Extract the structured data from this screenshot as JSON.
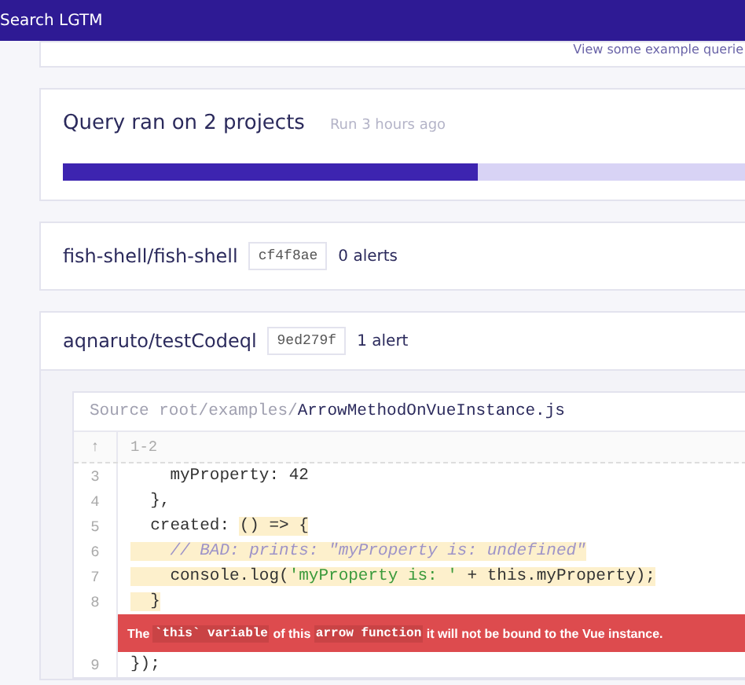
{
  "header": {
    "title": "Search LGTM"
  },
  "examples_link": "View some example querie",
  "summary": {
    "title": "Query ran on 2 projects",
    "time": "Run 3 hours ago",
    "level": 0.6
  },
  "projects": [
    {
      "name": "fish-shell/fish-shell",
      "commit": "cf4f8ae",
      "alerts": "0 alerts"
    },
    {
      "name": "aqnaruto/testCodeql",
      "commit": "9ed279f",
      "alerts": "1 alert",
      "source": {
        "prefix": "Source root/examples/",
        "file": "ArrowMethodOnVueInstance.js",
        "range": "1-2",
        "range_icon": "↑",
        "lines": [
          {
            "number": "3",
            "segments": [
              {
                "text": "    myProperty: 42",
                "kind": "plain",
                "highlighted": false
              }
            ]
          },
          {
            "number": "4",
            "segments": [
              {
                "text": "  },",
                "kind": "plain",
                "highlighted": false
              }
            ]
          },
          {
            "number": "5",
            "segments": [
              {
                "text": "  created: ",
                "kind": "plain",
                "highlighted": false
              },
              {
                "text": "() => {",
                "kind": "plain",
                "highlighted": true
              }
            ]
          },
          {
            "number": "6",
            "segments": [
              {
                "text": "    // BAD: prints: \"myProperty is: undefined\"",
                "kind": "comment",
                "highlighted": true
              }
            ]
          },
          {
            "number": "7",
            "segments": [
              {
                "text": "    console.log(",
                "kind": "plain",
                "highlighted": true
              },
              {
                "text": "'myProperty is: '",
                "kind": "string",
                "highlighted": true
              },
              {
                "text": " + this.myProperty);",
                "kind": "plain",
                "highlighted": true
              }
            ]
          },
          {
            "number": "8",
            "segments": [
              {
                "text": "  }",
                "kind": "plain",
                "highlighted": true
              }
            ]
          },
          {
            "kind": "alert",
            "segments": [
              {
                "text": "The ",
                "kind": "text"
              },
              {
                "text": "`this` variable",
                "kind": "code"
              },
              {
                "text": " of this ",
                "kind": "text"
              },
              {
                "text": "arrow function",
                "kind": "code"
              },
              {
                "text": " it will not be bound to the Vue instance.",
                "kind": "text"
              }
            ]
          },
          {
            "number": "9",
            "segments": [
              {
                "text": "});",
                "kind": "plain",
                "highlighted": false
              }
            ]
          }
        ]
      }
    }
  ]
}
